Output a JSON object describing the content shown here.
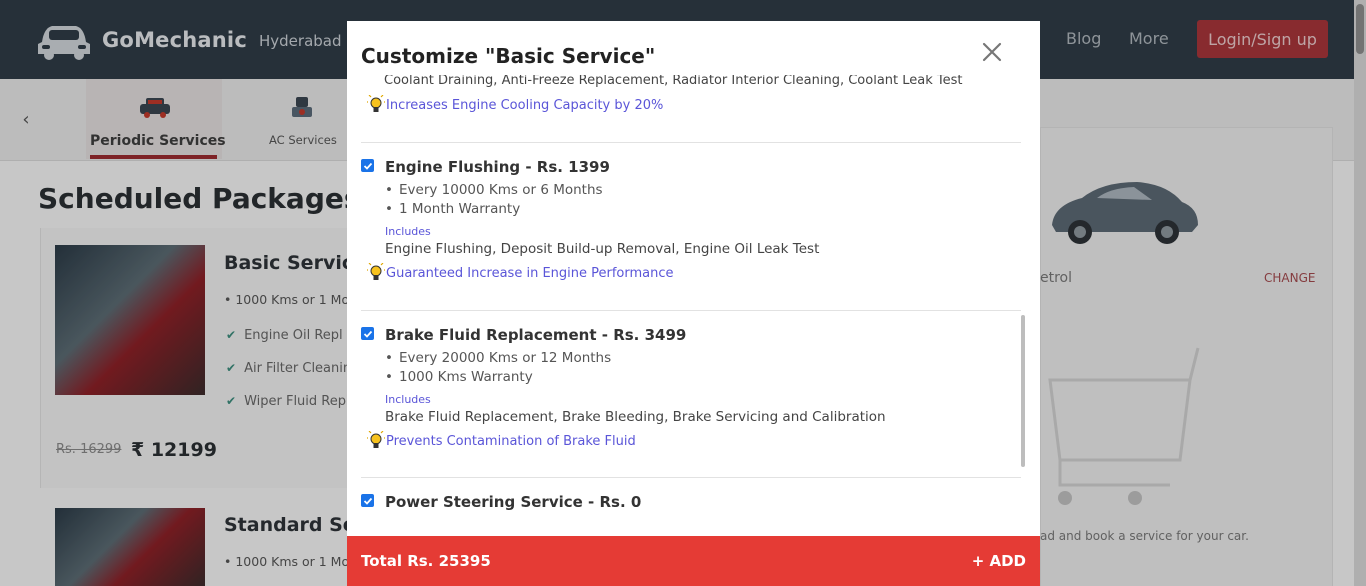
{
  "header": {
    "brand": "GoMechanic",
    "city": "Hyderabad",
    "nav": [
      "Blog",
      "More"
    ],
    "login_label": "Login/Sign up"
  },
  "categories": [
    {
      "label": "Periodic Services",
      "icon": "car-service-icon",
      "active": true
    },
    {
      "label": "AC Services",
      "icon": "ac-service-icon",
      "active": false
    }
  ],
  "main": {
    "section_title": "Scheduled Packages",
    "packages": [
      {
        "title": "Basic Servic",
        "subtitle": "• 1000 Kms or 1 Mo",
        "features": [
          "Engine Oil Repl",
          "Air Filter Cleanin",
          "Wiper Fluid Rep"
        ],
        "old_price": "Rs. 16299",
        "price": "₹ 12199"
      },
      {
        "title": "Standard Se",
        "subtitle": "• 1000 Kms or 1 Mo"
      }
    ]
  },
  "sidebar": {
    "fuel": "etrol",
    "change_label": "CHANGE",
    "empty_text": "ad and book a service for your car."
  },
  "modal": {
    "title": "Customize \"Basic Service\"",
    "cut_text": "Coolant Draining, Anti-Freeze Replacement, Radiator Interior Cleaning, Coolant Leak Test",
    "first_tip": "Increases Engine Cooling Capacity by 20%",
    "services": [
      {
        "name": "Engine Flushing - Rs. 1399",
        "checked": true,
        "bullets": [
          "Every 10000 Kms or 6 Months",
          "1 Month Warranty"
        ],
        "includes_label": "Includes",
        "includes": "Engine Flushing, Deposit Build-up Removal, Engine Oil Leak Test",
        "tip": "Guaranteed Increase in Engine Performance"
      },
      {
        "name": "Brake Fluid Replacement - Rs. 3499",
        "checked": true,
        "bullets": [
          "Every 20000 Kms or 12 Months",
          "1000 Kms Warranty"
        ],
        "includes_label": "Includes",
        "includes": "Brake Fluid Replacement, Brake Bleeding, Brake Servicing and Calibration",
        "tip": "Prevents Contamination of Brake Fluid"
      },
      {
        "name": "Power Steering Service - Rs. 0",
        "checked": true
      }
    ],
    "total": "Total Rs. 25395",
    "add_label": "+ ADD"
  },
  "colors": {
    "accent_red": "#e53b35",
    "link_blue": "#5a55d8",
    "checkbox_blue": "#1a73e8",
    "topbar": "#2f3b46"
  }
}
